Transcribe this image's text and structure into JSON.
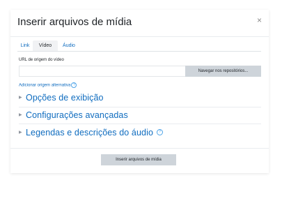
{
  "dialog": {
    "title": "Inserir arquivos de mídia",
    "close_glyph": "×"
  },
  "tabs": [
    {
      "label": "Link",
      "active": false
    },
    {
      "label": "Vídeo",
      "active": true
    },
    {
      "label": "Áudio",
      "active": false
    }
  ],
  "source": {
    "label": "URL de origem do vídeo",
    "value": "",
    "browse_label": "Navegar nos repositórios...",
    "add_alt_label": "Adicionar origem alternativa",
    "help_glyph": "?"
  },
  "sections": [
    {
      "label": "Opções de exibição",
      "has_help": false
    },
    {
      "label": "Configurações avançadas",
      "has_help": false
    },
    {
      "label": "Legendas e descrições do áudio",
      "has_help": true
    }
  ],
  "footer": {
    "insert_label": "Inserir arquivos de mídia"
  },
  "colors": {
    "link": "#0f6cbf",
    "button_bg": "#ced4da",
    "help": "#4ea4e8"
  },
  "icons": {
    "close": "close-icon",
    "chevron": "chevron-right-icon",
    "help": "help-icon"
  }
}
